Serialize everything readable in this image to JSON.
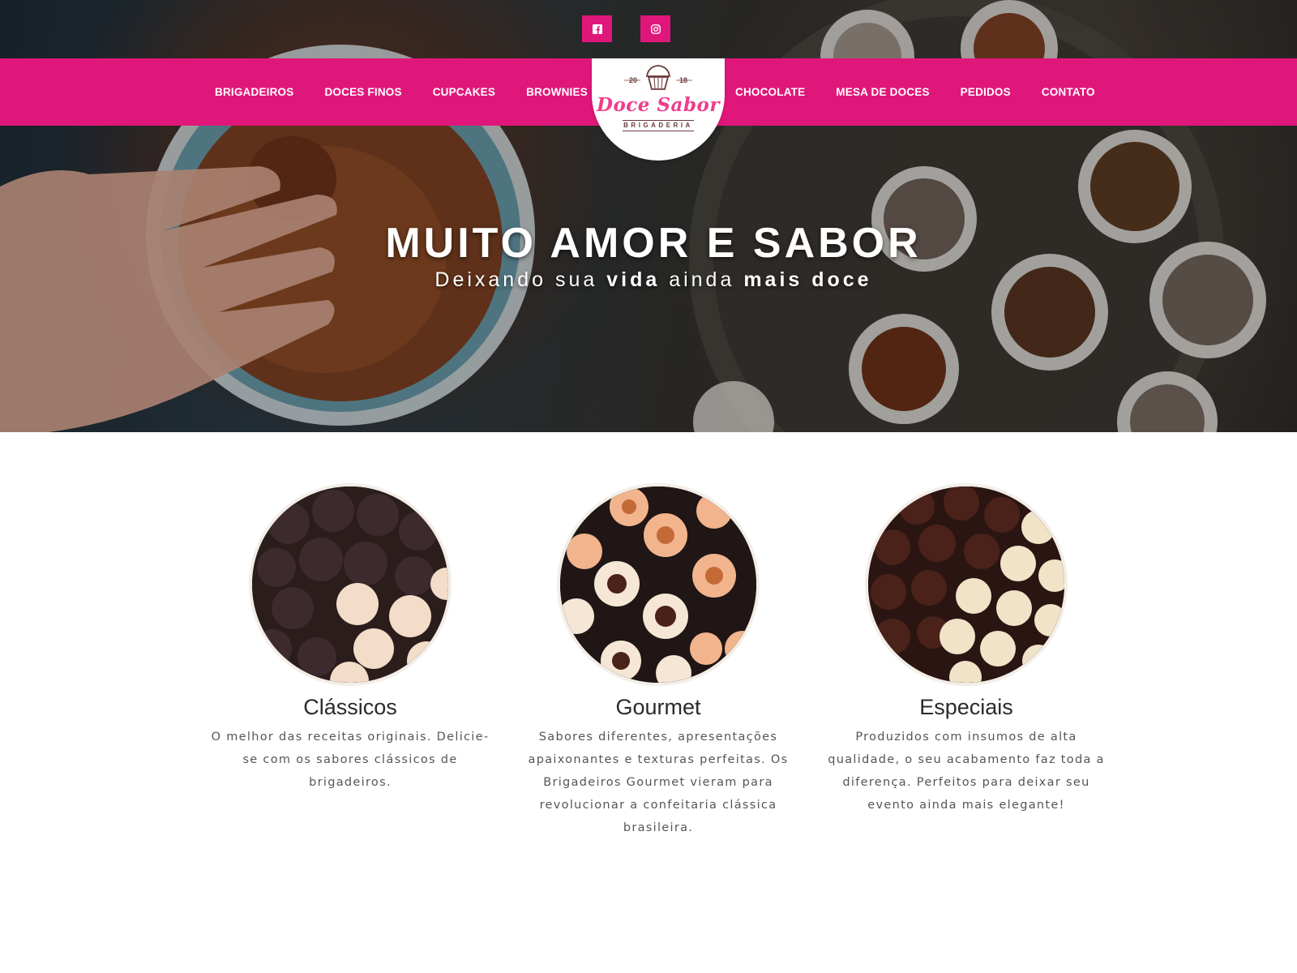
{
  "colors": {
    "brand_pink": "#e0177a",
    "logo_pink": "#ee3d8c",
    "logo_brown": "#6b3a3a"
  },
  "social": [
    {
      "icon": "facebook-icon"
    },
    {
      "icon": "instagram-icon"
    }
  ],
  "nav": {
    "left": [
      "BRIGADEIROS",
      "DOCES FINOS",
      "CUPCAKES",
      "BROWNIES"
    ],
    "right": [
      "CHOCOLATE",
      "MESA DE DOCES",
      "PEDIDOS",
      "CONTATO"
    ]
  },
  "logo": {
    "year_left": "20",
    "year_right": "18",
    "name": "Doce Sabor",
    "tagline": "BRIGADERIA",
    "icon": "cupcake-icon"
  },
  "hero": {
    "title": "MUITO AMOR E SABOR",
    "subtitle_parts": [
      "Deixando sua ",
      "vida",
      " ainda ",
      "mais doce"
    ]
  },
  "features": [
    {
      "title": "Clássicos",
      "text": "O melhor das receitas originais. Delicie-se com os sabores clássicos de brigadeiros."
    },
    {
      "title": "Gourmet",
      "text": "Sabores diferentes, apresentações apaixonantes e texturas perfeitas. Os Brigadeiros Gourmet vieram para revolucionar a confeitaria clássica brasileira."
    },
    {
      "title": "Especiais",
      "text": "Produzidos com insumos de alta qualidade, o seu acabamento faz toda a diferença. Perfeitos para deixar seu evento ainda mais elegante!"
    }
  ]
}
